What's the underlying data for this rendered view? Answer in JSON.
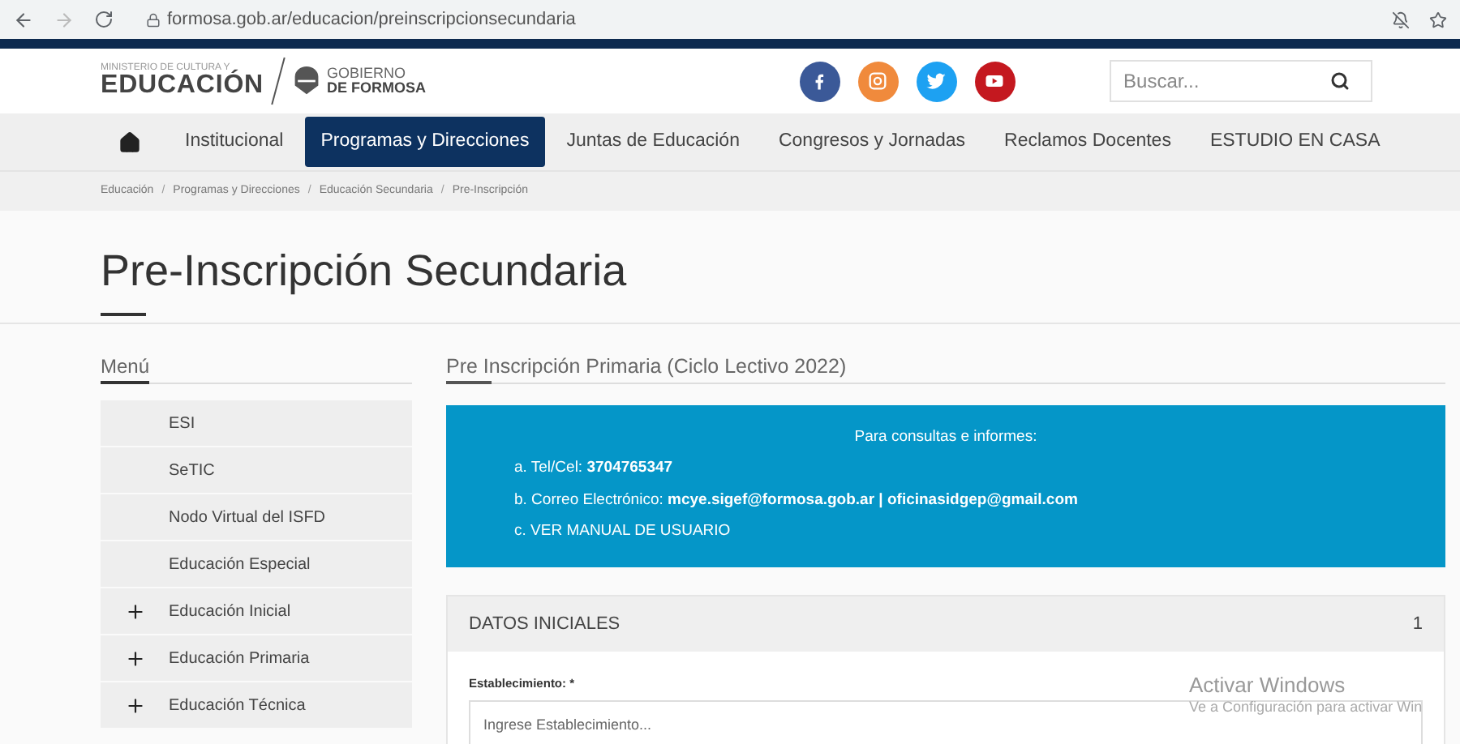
{
  "browser": {
    "url": "formosa.gob.ar/educacion/preinscripcionsecundaria"
  },
  "header": {
    "logo_top": "MINISTERIO DE CULTURA Y",
    "logo_main": "EDUCACIÓN",
    "gov_top": "GOBIERNO",
    "gov_bottom": "DE FORMOSA",
    "search": {
      "placeholder": "Buscar..."
    },
    "social": [
      {
        "kind": "facebook",
        "color": "#3b5998"
      },
      {
        "kind": "instagram",
        "color": "#f08a3c"
      },
      {
        "kind": "twitter",
        "color": "#1da1f2"
      },
      {
        "kind": "youtube",
        "color": "#c4181f"
      }
    ]
  },
  "nav": [
    {
      "label": "Institucional",
      "selected": false
    },
    {
      "label": "Programas y Direcciones",
      "selected": true
    },
    {
      "label": "Juntas de Educación",
      "selected": false
    },
    {
      "label": "Congresos y Jornadas",
      "selected": false
    },
    {
      "label": "Reclamos Docentes",
      "selected": false
    },
    {
      "label": "ESTUDIO EN CASA",
      "selected": false
    }
  ],
  "breadcrumb": [
    {
      "kind": "link",
      "text": "Educación"
    },
    {
      "kind": "separator",
      "text": "/"
    },
    {
      "kind": "link",
      "text": "Programas y Direcciones"
    },
    {
      "kind": "separator",
      "text": "/"
    },
    {
      "kind": "link",
      "text": "Educación Secundaria"
    },
    {
      "kind": "separator",
      "text": "/"
    },
    {
      "kind": "link",
      "text": "Pre-Inscripción"
    }
  ],
  "page_title": "Pre-Inscripción Secundaria",
  "sidebar": {
    "title": "Menú",
    "items": [
      {
        "label": "ESI",
        "kind": "plain"
      },
      {
        "label": "SeTIC",
        "kind": "plain"
      },
      {
        "label": "Nodo Virtual del ISFD",
        "kind": "plain"
      },
      {
        "label": "Educación Especial",
        "kind": "plain"
      },
      {
        "label": "Educación Inicial",
        "kind": "expandable"
      },
      {
        "label": "Educación Primaria",
        "kind": "expandable"
      },
      {
        "label": "Educación Técnica",
        "kind": "expandable"
      }
    ]
  },
  "content": {
    "title": "Pre Inscripción Primaria (Ciclo Lectivo 2022)",
    "info": {
      "heading": "Para consultas e informes:",
      "lines": [
        "a. Tel/Cel: **3704765347**",
        "b. Correo Electrónico: **mcye.sigef@formosa.gob.ar | oficinasidgep@gmail.com**",
        "c. VER MANUAL DE USUARIO"
      ]
    },
    "section": {
      "title": "DATOS INICIALES",
      "number": "1",
      "field_label": "Establecimiento: *",
      "field": {
        "placeholder": "Ingrese Establecimiento..."
      }
    }
  },
  "os_notice": {
    "title": "Activar Windows",
    "text": "Ve a Configuración para activar Win"
  }
}
